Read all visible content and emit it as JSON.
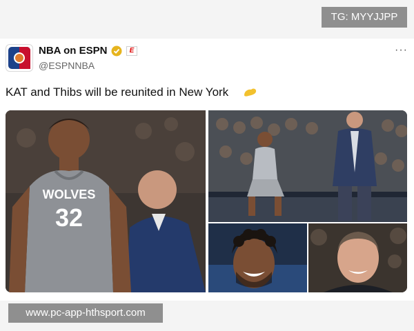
{
  "overlay": {
    "tg_badge": "TG: MYYJJPP",
    "watermark": "www.pc-app-hthsport.com"
  },
  "tweet": {
    "account_name": "NBA on ESPN",
    "handle": "@ESPNNBA",
    "text": "KAT and Thibs will be reunited in New York",
    "more_label": "···",
    "espn_badge": "E"
  },
  "photo1": {
    "jersey_team": "WOLVES",
    "jersey_number": "32"
  },
  "colors": {
    "accent_verified": "#e6b41e",
    "espn_red": "#cc0000",
    "jersey_gray": "#8e9196",
    "suit_navy": "#243a6b"
  },
  "icons": [
    "nba-logo-icon",
    "verified-badge-icon",
    "espn-badge-icon",
    "more-options-icon",
    "flexed-biceps-emoji-icon"
  ]
}
